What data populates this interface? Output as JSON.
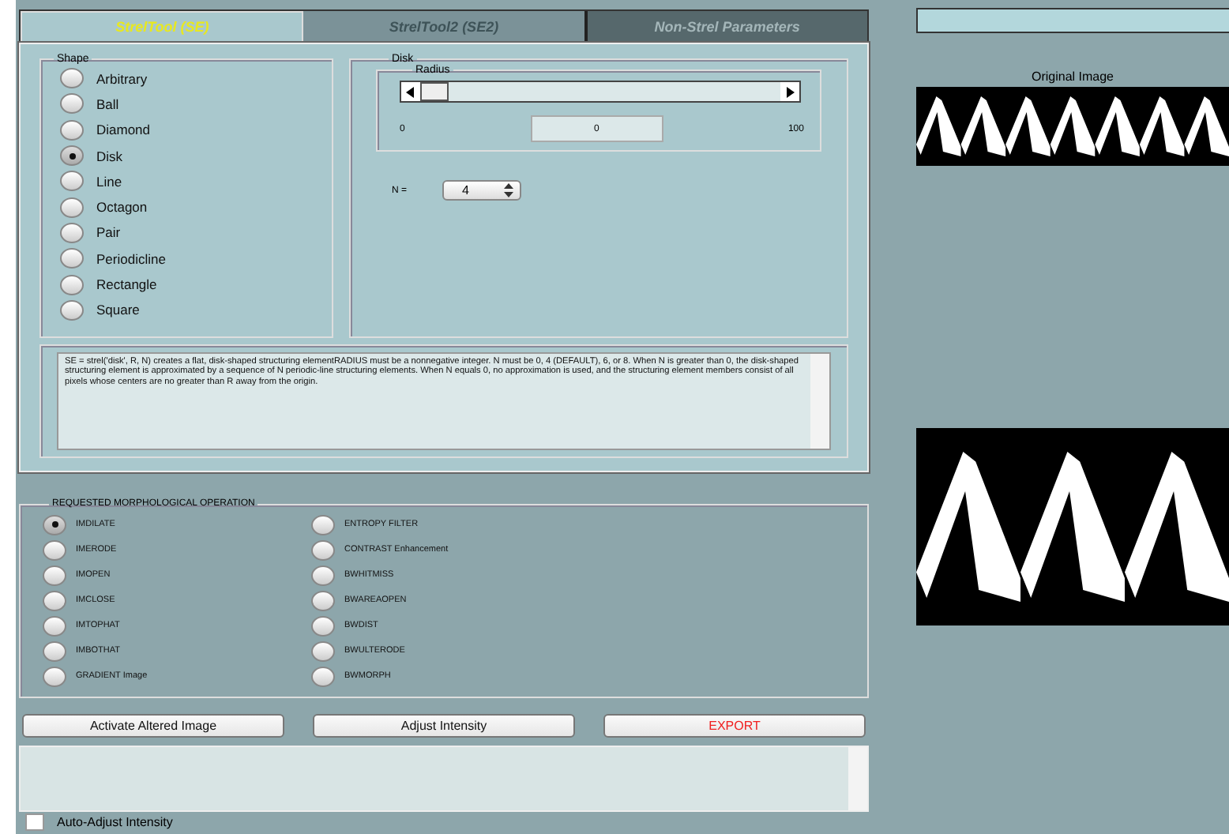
{
  "tabs": [
    {
      "label": "StrelTool (SE)",
      "selected": true
    },
    {
      "label": "StrelTool2 (SE2)",
      "selected": false
    },
    {
      "label": "Non-Strel Parameters",
      "selected": false
    }
  ],
  "shape_panel": {
    "title": "Shape",
    "options": [
      {
        "label": "Arbitrary",
        "selected": false
      },
      {
        "label": "Ball",
        "selected": false
      },
      {
        "label": "Diamond",
        "selected": false
      },
      {
        "label": "Disk",
        "selected": true
      },
      {
        "label": "Line",
        "selected": false
      },
      {
        "label": "Octagon",
        "selected": false
      },
      {
        "label": "Pair",
        "selected": false
      },
      {
        "label": "Periodicline",
        "selected": false
      },
      {
        "label": "Rectangle",
        "selected": false
      },
      {
        "label": "Square",
        "selected": false
      }
    ]
  },
  "disk_panel": {
    "title": "Disk",
    "radius": {
      "title": "Radius",
      "level": 0,
      "min_label": "0",
      "value": "0",
      "max_label": "100"
    },
    "n_label": "N =",
    "n_value": "4"
  },
  "description": "SE = strel('disk', R, N) creates a flat, disk-shaped structuring elementRADIUS must be a nonnegative integer. N must be 0, 4 (DEFAULT), 6, or 8. When N is greater than 0, the disk-shaped structuring element is approximated by a sequence of N periodic-line structuring elements. When N equals 0, no approximation is used, and the structuring element members consist of all pixels whose centers are no greater than R away from the origin.",
  "operations": {
    "title": "REQUESTED MORPHOLOGICAL OPERATION",
    "options": [
      {
        "label": "IMDILATE",
        "selected": true
      },
      {
        "label": "IMERODE",
        "selected": false
      },
      {
        "label": "IMOPEN",
        "selected": false
      },
      {
        "label": "IMCLOSE",
        "selected": false
      },
      {
        "label": "IMTOPHAT",
        "selected": false
      },
      {
        "label": "IMBOTHAT",
        "selected": false
      },
      {
        "label": "GRADIENT Image",
        "selected": false
      },
      {
        "label": "ENTROPY FILTER",
        "selected": false
      },
      {
        "label": "CONTRAST Enhancement",
        "selected": false
      },
      {
        "label": "BWHITMISS",
        "selected": false
      },
      {
        "label": "BWAREAOPEN",
        "selected": false
      },
      {
        "label": "BWDIST",
        "selected": false
      },
      {
        "label": "BWULTERODE",
        "selected": false
      },
      {
        "label": "BWMORPH",
        "selected": false
      }
    ]
  },
  "buttons": [
    {
      "label": "Activate Altered Image",
      "kind": "normal"
    },
    {
      "label": "Adjust Intensity",
      "kind": "normal"
    },
    {
      "label": "EXPORT",
      "kind": "danger"
    }
  ],
  "auto_adjust": {
    "label": "Auto-Adjust Intensity",
    "checked": false
  },
  "images": [
    {
      "caption": "Original Image",
      "kind": "picture"
    },
    {
      "kind": "picture"
    }
  ]
}
